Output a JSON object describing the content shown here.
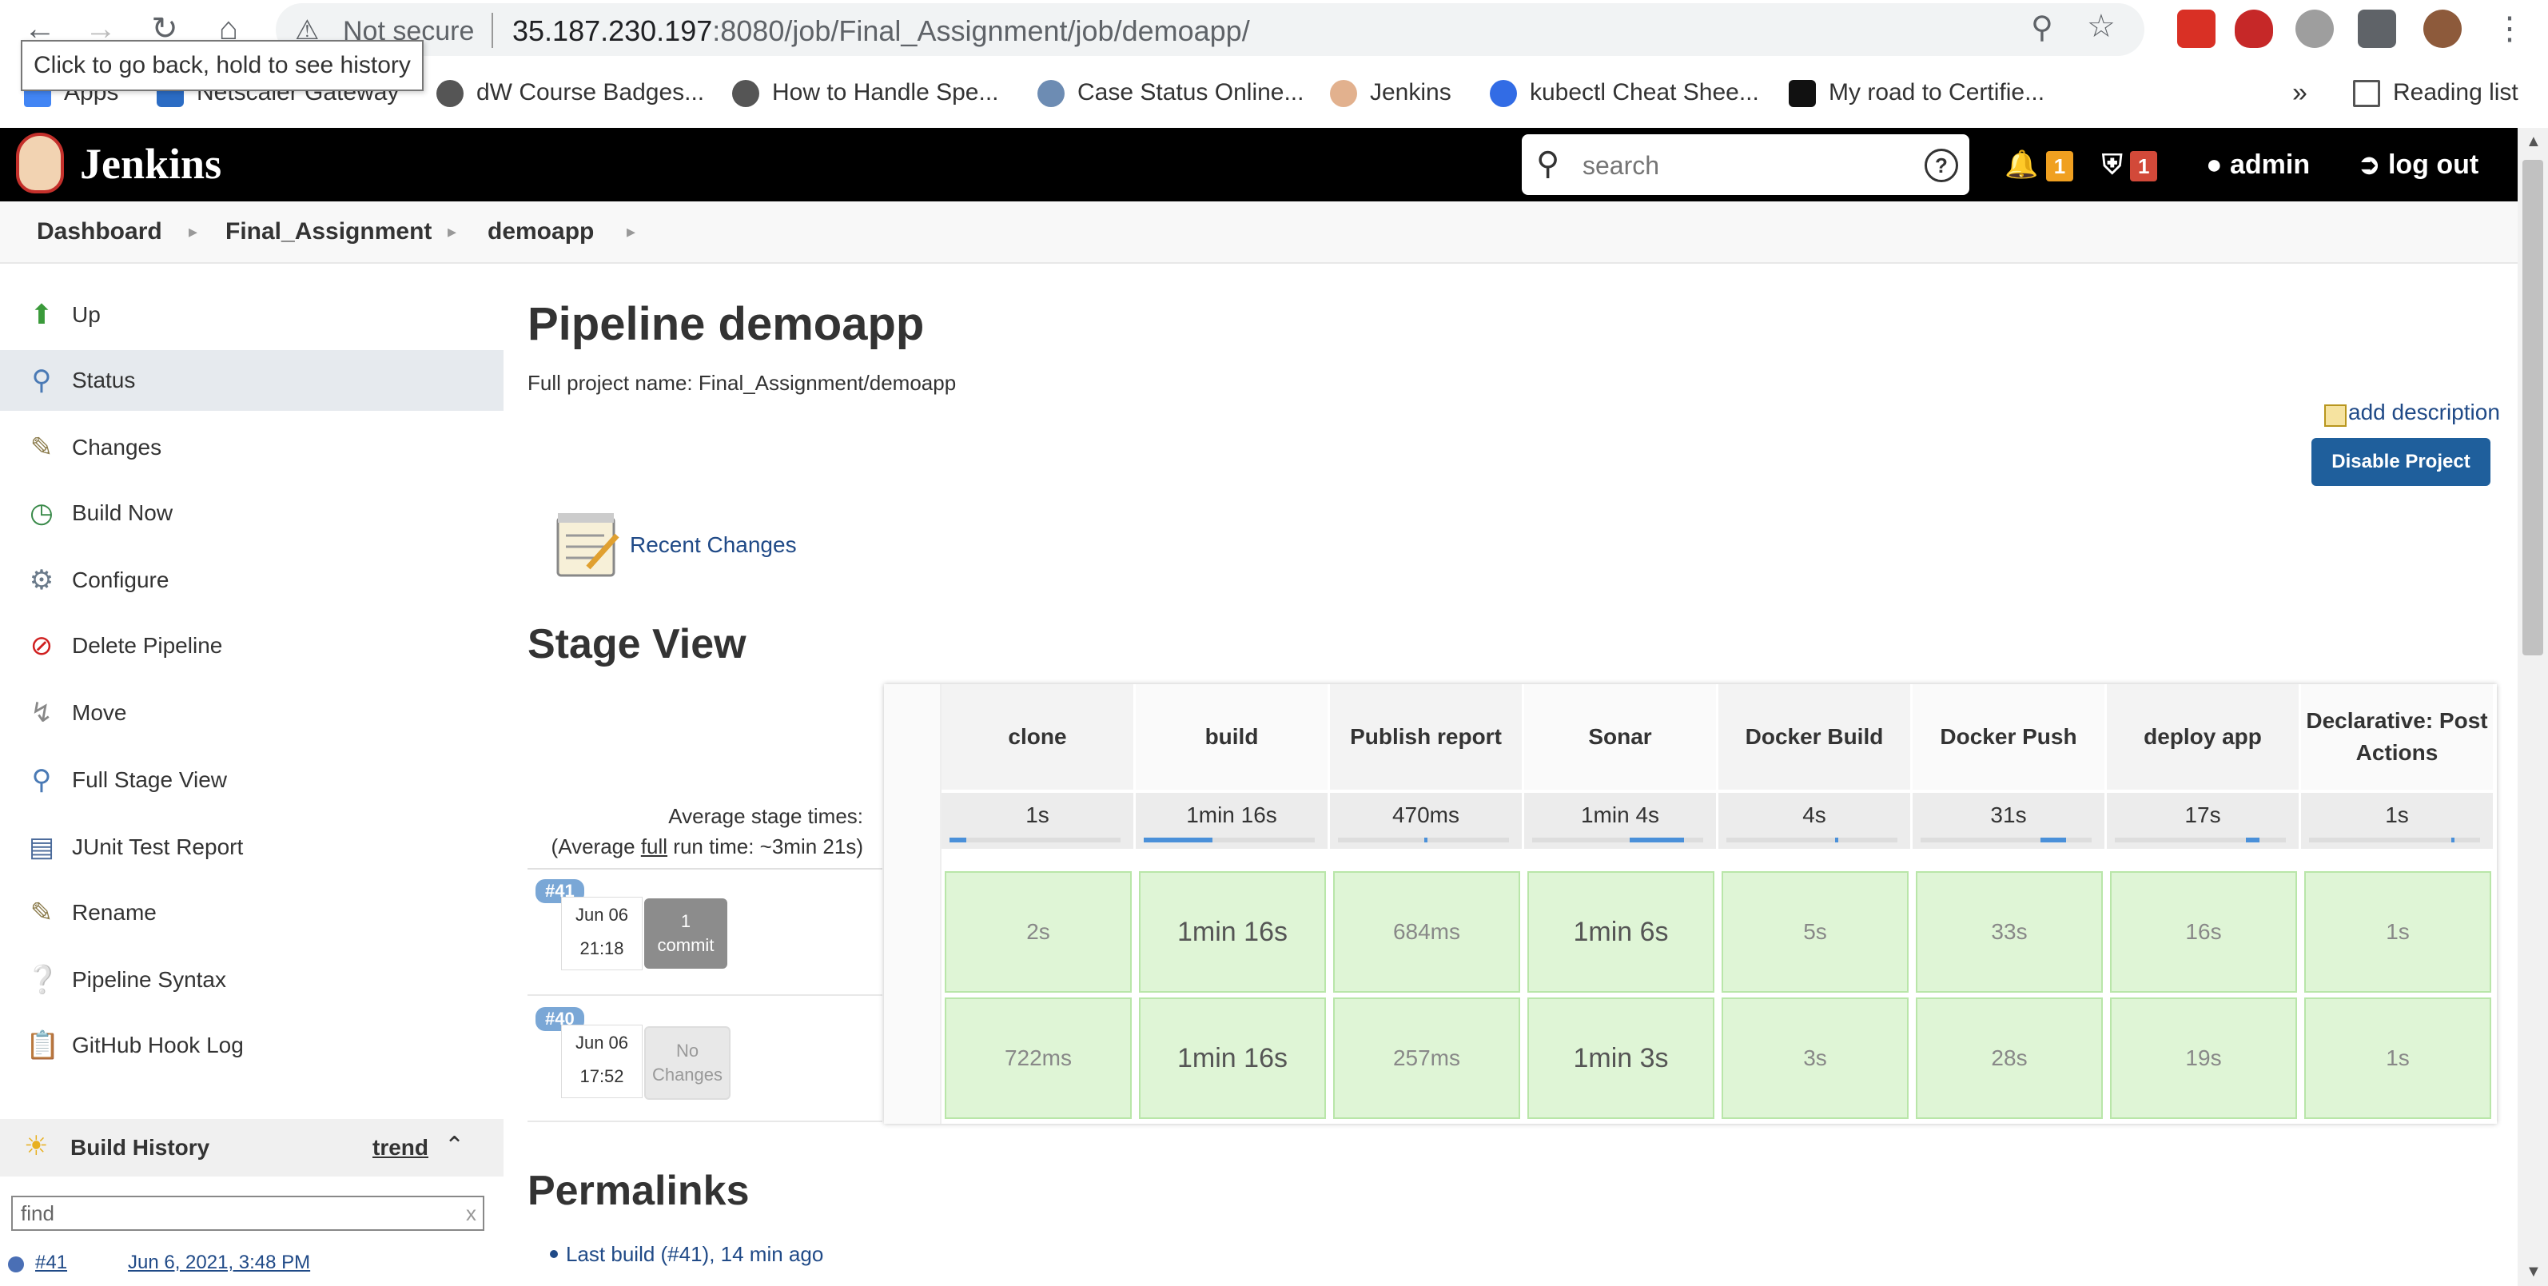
{
  "browser": {
    "not_secure": "Not secure",
    "url_host": "35.187.230.197",
    "url_port": ":8080",
    "url_path": "/job/Final_Assignment/job/demoapp/",
    "tooltip": "Click to go back, hold to see history",
    "bookmarks": [
      "Apps",
      "Netscaler Gateway",
      "dW Course Badges...",
      "How to Handle Spe...",
      "Case Status Online...",
      "Jenkins",
      "kubectl Cheat Shee...",
      "My road to Certifie..."
    ],
    "more": "»",
    "reading_list": "Reading list"
  },
  "header": {
    "title": "Jenkins",
    "search_placeholder": "search",
    "notifications_count": "1",
    "security_count": "1",
    "user": "admin",
    "logout": "log out"
  },
  "breadcrumb": [
    "Dashboard",
    "Final_Assignment",
    "demoapp"
  ],
  "sidebar": {
    "items": [
      {
        "label": "Up",
        "icon": "up-arrow-icon"
      },
      {
        "label": "Status",
        "icon": "magnifier-icon"
      },
      {
        "label": "Changes",
        "icon": "notepad-icon"
      },
      {
        "label": "Build Now",
        "icon": "clock-play-icon"
      },
      {
        "label": "Configure",
        "icon": "gear-icon"
      },
      {
        "label": "Delete Pipeline",
        "icon": "no-entry-icon"
      },
      {
        "label": "Move",
        "icon": "move-icon"
      },
      {
        "label": "Full Stage View",
        "icon": "magnifier-icon"
      },
      {
        "label": "JUnit Test Report",
        "icon": "chart-icon"
      },
      {
        "label": "Rename",
        "icon": "notepad-icon"
      },
      {
        "label": "Pipeline Syntax",
        "icon": "help-icon"
      },
      {
        "label": "GitHub Hook Log",
        "icon": "clipboard-icon"
      }
    ],
    "build_history": {
      "title": "Build History",
      "trend": "trend",
      "find_placeholder": "find",
      "clear": "x",
      "first_build": "#41",
      "first_build_date": "Jun 6, 2021, 3:48 PM"
    }
  },
  "main": {
    "title": "Pipeline demoapp",
    "full_name": "Full project name: Final_Assignment/demoapp",
    "add_description": "add description",
    "disable_button": "Disable Project",
    "recent_changes": "Recent Changes",
    "stage_view_title": "Stage View",
    "avg_stage_label": "Average stage times:",
    "avg_run_prefix": "(Average ",
    "avg_run_link": "full",
    "avg_run_suffix": " run time: ~3min 21s)",
    "permalinks_title": "Permalinks",
    "permalink_1": "Last build (#41), 14 min ago"
  },
  "stages": [
    {
      "name": "clone",
      "avg": "1s",
      "fill": 0.1
    },
    {
      "name": "build",
      "avg": "1min 16s",
      "fill": 0.4
    },
    {
      "name": "Publish report",
      "avg": "470ms",
      "fill": 0.02
    },
    {
      "name": "Sonar",
      "avg": "1min 4s",
      "fill": 0.32
    },
    {
      "name": "Docker Build",
      "avg": "4s",
      "fill": 0.02
    },
    {
      "name": "Docker Push",
      "avg": "31s",
      "fill": 0.15
    },
    {
      "name": "deploy app",
      "avg": "17s",
      "fill": 0.08
    },
    {
      "name": "Declarative: Post Actions",
      "avg": "1s",
      "fill": 0.01
    }
  ],
  "runs": [
    {
      "id": "#41",
      "date": "Jun 06",
      "time": "21:18",
      "changes_line1": "1",
      "changes_line2": "commit",
      "times": [
        "2s",
        "1min 16s",
        "684ms",
        "1min 6s",
        "5s",
        "33s",
        "16s",
        "1s"
      ]
    },
    {
      "id": "#40",
      "date": "Jun 06",
      "time": "17:52",
      "changes_line1": "No",
      "changes_line2": "Changes",
      "times": [
        "722ms",
        "1min 16s",
        "257ms",
        "1min 3s",
        "3s",
        "28s",
        "19s",
        "1s"
      ]
    }
  ],
  "colors": {
    "accent": "#1f5f9c",
    "stage_success": "#dff5d6",
    "header_bg": "#000000"
  }
}
